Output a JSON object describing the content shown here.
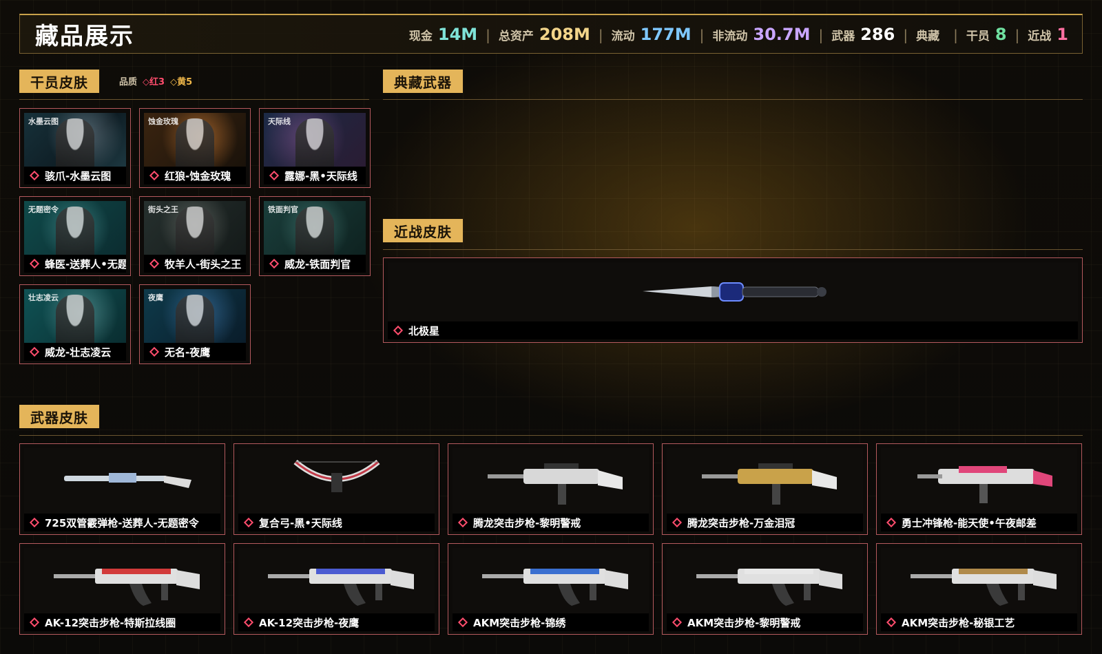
{
  "header": {
    "title": "藏品展示",
    "stats": [
      {
        "label": "现金",
        "value": "14M",
        "color": "#7fe3d8"
      },
      {
        "label": "总资产",
        "value": "208M",
        "color": "#f3d58a"
      },
      {
        "label": "流动",
        "value": "177M",
        "color": "#7fc8ff"
      },
      {
        "label": "非流动",
        "value": "30.7M",
        "color": "#c9a6ff"
      },
      {
        "label": "武器",
        "value": "286",
        "color": "#ffffff"
      },
      {
        "label": "典藏",
        "value": "",
        "color": "#ffffff"
      },
      {
        "label": "干员",
        "value": "8",
        "color": "#6fe0a0"
      },
      {
        "label": "近战",
        "value": "1",
        "color": "#ff6fa0"
      }
    ]
  },
  "sections": {
    "operator_skins": "干员皮肤",
    "quality_label": "品质",
    "quality_red": "红3",
    "quality_yellow": "黄5",
    "collection_weapons": "典藏武器",
    "melee_skins": "近战皮肤",
    "weapon_skins": "武器皮肤"
  },
  "operators": [
    {
      "name": "骇爪-水墨云图",
      "art": "水墨云图"
    },
    {
      "name": "红狼-蚀金玫瑰",
      "art": "蚀金玫瑰"
    },
    {
      "name": "露娜-黑•天际线",
      "art": "天际线"
    },
    {
      "name": "蜂医-送葬人•无题密令",
      "art": "无题密令"
    },
    {
      "name": "牧羊人-街头之王",
      "art": "街头之王"
    },
    {
      "name": "威龙-铁面判官",
      "art": "铁面判官"
    },
    {
      "name": "威龙-壮志凌云",
      "art": "壮志凌云"
    },
    {
      "name": "无名-夜鹰",
      "art": "夜鹰"
    }
  ],
  "melee": [
    {
      "name": "北极星"
    }
  ],
  "weapons": [
    {
      "name": "725双管霰弹枪-送葬人-无题密令",
      "kind": "shotgun",
      "accent": "#9fb7d8"
    },
    {
      "name": "复合弓-黑•天际线",
      "kind": "bow",
      "accent": "#c23a48"
    },
    {
      "name": "腾龙突击步枪-黎明警戒",
      "kind": "rifle",
      "accent": "#d8d8d8"
    },
    {
      "name": "腾龙突击步枪-万金泪冠",
      "kind": "rifle",
      "accent": "#c9a24a"
    },
    {
      "name": "勇士冲锋枪-能天使•午夜邮差",
      "kind": "smg",
      "accent": "#e0467a"
    },
    {
      "name": "AK-12突击步枪-特斯拉线圈",
      "kind": "ak",
      "accent": "#d23a3a"
    },
    {
      "name": "AK-12突击步枪-夜鹰",
      "kind": "ak",
      "accent": "#4b5bd1"
    },
    {
      "name": "AKM突击步枪-锦绣",
      "kind": "ak",
      "accent": "#3a6fd0"
    },
    {
      "name": "AKM突击步枪-黎明警戒",
      "kind": "ak",
      "accent": "#e8e8e8"
    },
    {
      "name": "AKM突击步枪-秘银工艺",
      "kind": "ak",
      "accent": "#b08a4a"
    }
  ]
}
